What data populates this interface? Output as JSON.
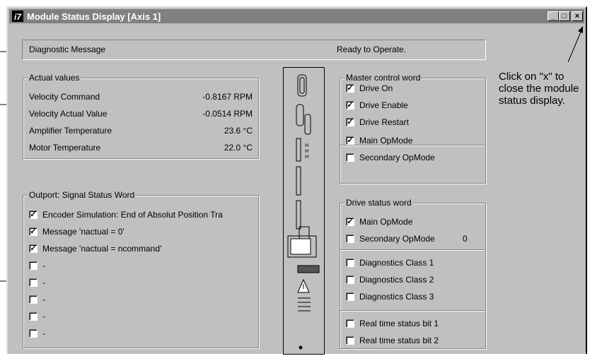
{
  "window": {
    "title": "Module Status Display [Axis 1]",
    "app_icon_glyph": "i7",
    "minimize_glyph": "_",
    "maximize_glyph": "□",
    "close_glyph": "×"
  },
  "diagnostic": {
    "label": "Diagnostic Message",
    "value": "Ready to Operate."
  },
  "actual_values": {
    "title": "Actual values",
    "rows": [
      {
        "label": "Velocity Command",
        "value": "-0.8167 RPM"
      },
      {
        "label": "Velocity Actual Value",
        "value": "-0.0514 RPM"
      },
      {
        "label": "Amplifier Temperature",
        "value": "23.6 °C"
      },
      {
        "label": "Motor Temperature",
        "value": "22.0 °C"
      }
    ]
  },
  "outport": {
    "title": "Outport: Signal Status Word",
    "items": [
      {
        "label": "Encoder Simulation: End of Absolut Position Tra",
        "checked": true
      },
      {
        "label": "Message 'nactual = 0'",
        "checked": true
      },
      {
        "label": "Message 'nactual = ncommand'",
        "checked": true
      },
      {
        "label": "-",
        "checked": false
      },
      {
        "label": "-",
        "checked": false
      },
      {
        "label": "-",
        "checked": false
      },
      {
        "label": "-",
        "checked": false
      },
      {
        "label": "-",
        "checked": false
      }
    ]
  },
  "master_control": {
    "title": "Master control word",
    "items": [
      {
        "label": "Drive On",
        "checked": true
      },
      {
        "label": "Drive Enable",
        "checked": true
      },
      {
        "label": "Drive Restart",
        "checked": true
      },
      {
        "label": "Main OpMode",
        "checked": true
      },
      {
        "label": "Secondary OpMode",
        "checked": false
      }
    ]
  },
  "drive_status": {
    "title": "Drive status word",
    "items": [
      {
        "label": "Main OpMode",
        "checked": true
      },
      {
        "label": "Secondary OpMode",
        "checked": false
      },
      {
        "label": "Diagnostics Class 1",
        "checked": false
      },
      {
        "label": "Diagnostics Class 2",
        "checked": false
      },
      {
        "label": "Diagnostics Class 3",
        "checked": false
      },
      {
        "label": "Real time status bit 1",
        "checked": false
      },
      {
        "label": "Real time status bit 2",
        "checked": false
      }
    ],
    "secondary_value": "0"
  },
  "annotation": {
    "lines": [
      "Click on \"x\" to",
      "close the module",
      "status display."
    ]
  },
  "colors": {
    "window_bg": "#c0c0c0",
    "titlebar_inactive": "#808080"
  }
}
